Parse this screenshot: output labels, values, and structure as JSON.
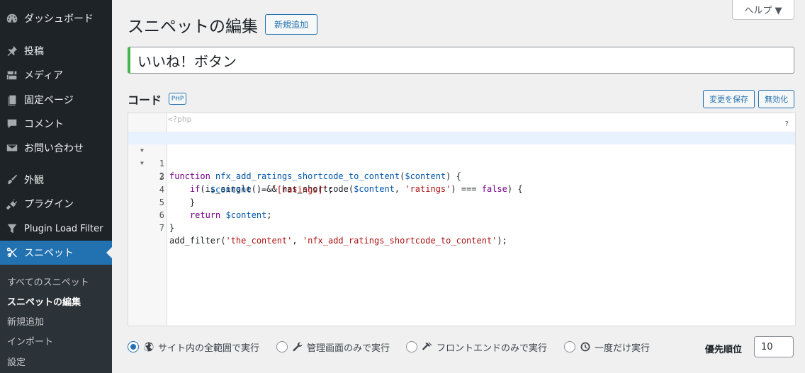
{
  "sidebar": {
    "items": [
      {
        "icon": "dashboard-icon",
        "label": "ダッシュボード"
      },
      {
        "icon": "pushpin-icon",
        "label": "投稿"
      },
      {
        "icon": "media-icon",
        "label": "メディア"
      },
      {
        "icon": "page-icon",
        "label": "固定ページ"
      },
      {
        "icon": "comment-icon",
        "label": "コメント"
      },
      {
        "icon": "mail-icon",
        "label": "お問い合わせ"
      },
      {
        "icon": "brush-icon",
        "label": "外観"
      },
      {
        "icon": "plugin-icon",
        "label": "プラグイン"
      },
      {
        "icon": "filter-icon",
        "label": "Plugin Load Filter"
      },
      {
        "icon": "scissors-icon",
        "label": "スニペット"
      }
    ],
    "submenu": [
      "すべてのスニペット",
      "スニペットの編集",
      "新規追加",
      "インポート",
      "設定"
    ]
  },
  "header": {
    "help_label": "ヘルプ ▼",
    "title": "スニペットの編集",
    "add_new_label": "新規追加"
  },
  "snippet": {
    "name": "いいね！ボタン",
    "code_heading": "コード",
    "lang_badge": "PHP",
    "save_label": "変更を保存",
    "deactivate_label": "無効化",
    "php_open": "<?php",
    "editor_help": "?",
    "code_lines": [
      "function nfx_add_ratings_shortcode_to_content($content) {",
      "    if(is_single() && has_shortcode($content, 'ratings') === false) {",
      "        $content .= '[ratings]';",
      "    }",
      "    return $content;",
      "}",
      "add_filter('the_content', 'nfx_add_ratings_shortcode_to_content');"
    ],
    "line_numbers": [
      "1",
      "2",
      "3",
      "4",
      "5",
      "6",
      "7"
    ]
  },
  "scope": {
    "options": [
      {
        "icon": "globe-icon",
        "label": "サイト内の全範囲で実行",
        "selected": true
      },
      {
        "icon": "wrench-icon",
        "label": "管理画面のみで実行",
        "selected": false
      },
      {
        "icon": "hammer-icon",
        "label": "フロントエンドのみで実行",
        "selected": false
      },
      {
        "icon": "clock-icon",
        "label": "一度だけ実行",
        "selected": false
      }
    ],
    "priority_label": "優先順位",
    "priority_value": "10"
  },
  "colors": {
    "sidebar_bg": "#1d2327",
    "accent": "#2271b1",
    "title_border": "#46b450"
  }
}
